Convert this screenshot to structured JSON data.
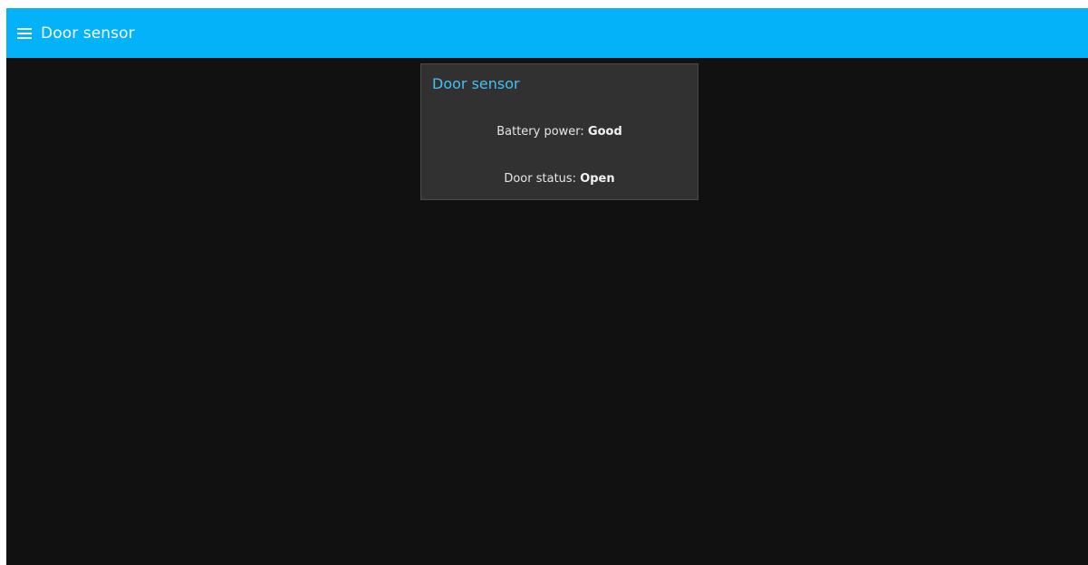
{
  "app_bar": {
    "menu_icon": "hamburger-menu-icon",
    "title": "Door sensor",
    "background_color": "#03b2f8"
  },
  "card": {
    "title": "Door sensor",
    "title_color": "#45c1f1",
    "battery": {
      "label": "Battery power:",
      "value": "Good"
    },
    "door": {
      "label": "Door status:",
      "value": "Open"
    }
  }
}
